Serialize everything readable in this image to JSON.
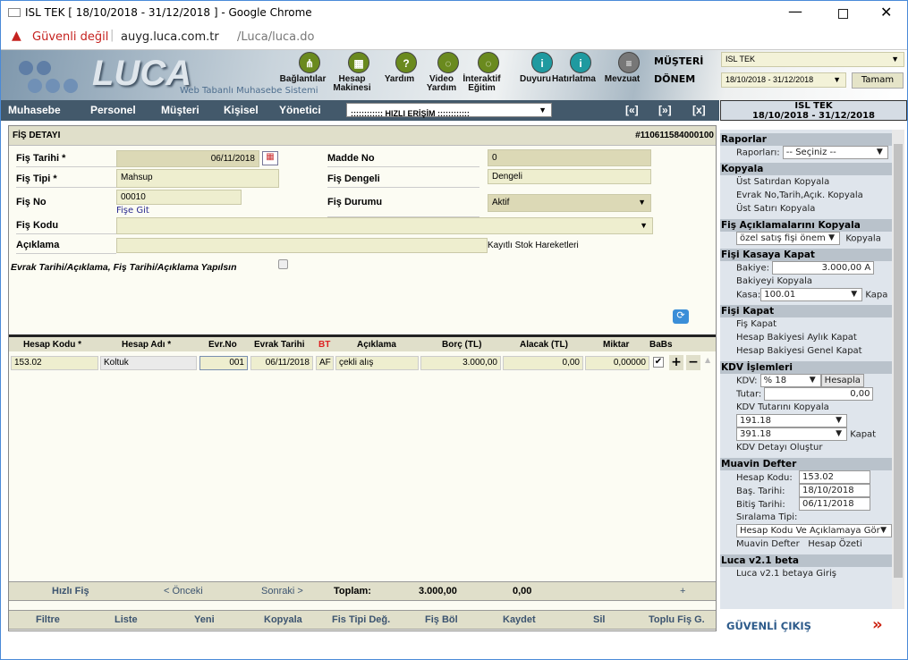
{
  "window": {
    "title": "ISL TEK [ 18/10/2018 - 31/12/2018 ] - Google Chrome",
    "security": "Güvenli değil",
    "url_host": "auyg.luca.com.tr",
    "url_path": "/Luca/luca.do"
  },
  "banner": {
    "logo": "LUCA",
    "subtitle": "Web Tabanlı Muhasebe Sistemi",
    "tools": [
      {
        "label": "Bağlantılar",
        "icon": "share-icon"
      },
      {
        "label": "Hesap Makinesi",
        "icon": "calculator-icon"
      },
      {
        "label": "Yardım",
        "icon": "help-icon"
      },
      {
        "label": "Video Yardım",
        "icon": "chat-icon"
      },
      {
        "label": "İnteraktif Eğitim",
        "icon": "chat-icon"
      },
      {
        "label": "Duyuru",
        "icon": "info-icon"
      },
      {
        "label": "Hatırlatma",
        "icon": "info-icon"
      },
      {
        "label": "Mevzuat",
        "icon": "document-icon"
      }
    ],
    "musteri_label": "MÜŞTERİ",
    "musteri_value": "ISL TEK",
    "donem_label": "DÖNEM",
    "donem_value": "18/10/2018 - 31/12/2018",
    "ok_label": "Tamam"
  },
  "nav": {
    "items": [
      "Muhasebe",
      "Personel",
      "Müşteri",
      "Kişisel",
      "Yönetici"
    ],
    "quick": ":::::::::::: HIZLI ERİŞİM ::::::::::::",
    "prev": "[«]",
    "next": "[»]",
    "close": "[x]",
    "company": "ISL TEK",
    "period": "18/10/2018 - 31/12/2018"
  },
  "form": {
    "title": "FİŞ DETAYI",
    "number": "#110611584000100",
    "fis_tarihi_label": "Fiş Tarihi *",
    "fis_tarihi": "06/11/2018",
    "madde_no_label": "Madde No",
    "madde_no": "0",
    "fis_tipi_label": "Fiş Tipi *",
    "fis_tipi": "Mahsup",
    "fis_dengeli_label": "Fiş Dengeli",
    "fis_dengeli": "Dengeli",
    "fis_no_label": "Fiş No",
    "fis_no": "00010",
    "fise_git": "Fişe Git",
    "fis_durumu_label": "Fiş Durumu",
    "fis_durumu": "Aktif",
    "fis_kodu_label": "Fiş Kodu",
    "fis_kodu": "",
    "aciklama_label": "Açıklama",
    "aciklama": "",
    "stok_link": "Kayıtlı Stok Hareketleri",
    "evrak_check_label": "Evrak Tarihi/Açıklama, Fiş Tarihi/Açıklama Yapılsın",
    "evrak_checked": false
  },
  "table": {
    "headers": [
      "Hesap Kodu *",
      "Hesap Adı *",
      "Evr.No",
      "Evrak Tarihi",
      "BT",
      "Açıklama",
      "Borç (TL)",
      "Alacak (TL)",
      "Miktar",
      "BaBs"
    ],
    "rows": [
      {
        "hesap_kodu": "153.02",
        "hesap_adi": "Koltuk",
        "evr_no": "001",
        "evrak_tarihi": "06/11/2018",
        "bt": "AF",
        "aciklama": "çekli alış",
        "borc": "3.000,00",
        "alacak": "0,00",
        "miktar": "0,00000",
        "babs": true
      }
    ]
  },
  "footer": {
    "hizli": "Hızlı Fiş",
    "onceki": "< Önceki",
    "sonraki": "Sonraki >",
    "toplam_label": "Toplam:",
    "toplam_borc": "3.000,00",
    "toplam_alacak": "0,00",
    "plus": "+",
    "actions": [
      "Filtre",
      "Liste",
      "Yeni",
      "Kopyala",
      "Fis Tipi Değ.",
      "Fiş Böl",
      "Kaydet",
      "Sil",
      "Toplu Fiş G."
    ]
  },
  "panel": {
    "raporlar": {
      "title": "Raporlar",
      "label": "Raporları:",
      "value": "-- Seçiniz --"
    },
    "kopyala": {
      "title": "Kopyala",
      "items": [
        "Üst Satırdan Kopyala",
        "Evrak No,Tarih,Açık. Kopyala",
        "Üst Satırı Kopyala"
      ]
    },
    "aciklama": {
      "title": "Fiş Açıklamalarını Kopyala",
      "value": "özel satış fişi önem",
      "button": "Kopyala"
    },
    "kasa": {
      "title": "Fişi Kasaya Kapat",
      "bakiye_label": "Bakiye:",
      "bakiye": "3.000,00 A",
      "kopyala": "Bakiyeyi Kopyala",
      "kasa_label": "Kasa:",
      "kasa": "100.01",
      "kapat": "Kapa"
    },
    "fiskapat": {
      "title": "Fişi Kapat",
      "items": [
        "Fiş Kapat",
        "Hesap Bakiyesi Aylık Kapat",
        "Hesap Bakiyesi Genel Kapat"
      ]
    },
    "kdv": {
      "title": "KDV İşlemleri",
      "kdv_label": "KDV:",
      "kdv": "% 18",
      "hesapla": "Hesapla",
      "tutar_label": "Tutar:",
      "tutar": "0,00",
      "kopyala": "KDV Tutarını Kopyala",
      "acc1": "191.18",
      "acc2": "391.18",
      "kapat": "Kapat",
      "detay": "KDV Detayı Oluştur"
    },
    "muavin": {
      "title": "Muavin Defter",
      "hk_label": "Hesap Kodu:",
      "hk": "153.02",
      "bas_label": "Baş. Tarihi:",
      "bas": "18/10/2018",
      "bit_label": "Bitiş Tarihi:",
      "bit": "06/11/2018",
      "sira_label": "Sıralama Tipi:",
      "sira": "Hesap Kodu Ve Açıklamaya Gör",
      "defter": "Muavin Defter",
      "ozet": "Hesap Özeti"
    },
    "beta": {
      "title": "Luca v2.1 beta",
      "item": "Luca v2.1 betaya Giriş"
    },
    "logout": "GÜVENLİ ÇIKIŞ",
    "logout_icon": "»"
  }
}
